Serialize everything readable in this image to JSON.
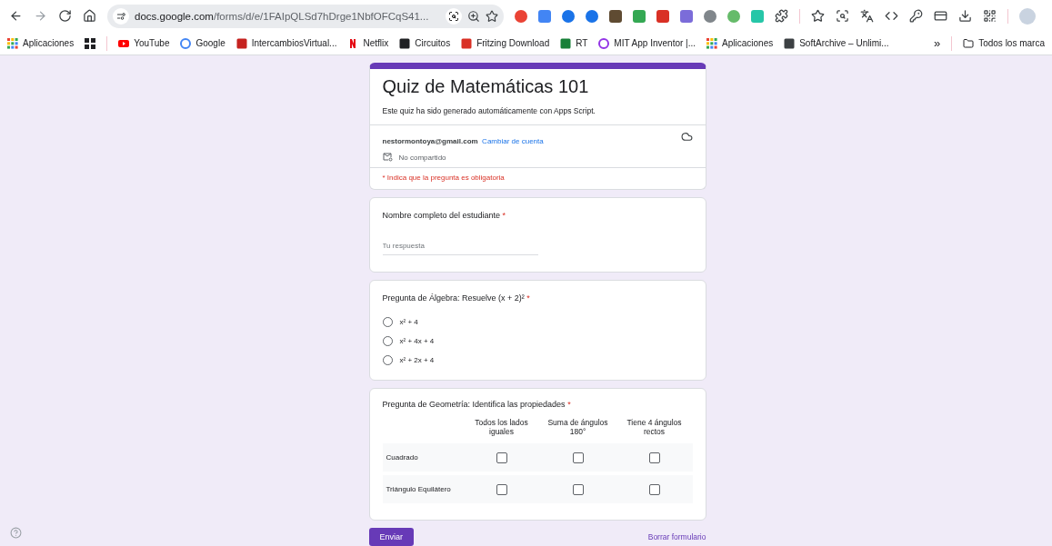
{
  "browser": {
    "address": {
      "domain": "docs.google.com",
      "path": "/forms/d/e/1FAIpQLSd7hDrge1NbfOFCqS41..."
    },
    "bookmarks": [
      {
        "label": "Aplicaciones",
        "kind": "apps"
      },
      {
        "kind": "grid",
        "color": "#202124"
      },
      {
        "label": "YouTube",
        "kind": "play",
        "color": "#ff0000"
      },
      {
        "label": "Google",
        "kind": "circle",
        "color": "#4285f4"
      },
      {
        "label": "IntercambiosVirtual...",
        "kind": "square",
        "color": "#c5221f"
      },
      {
        "label": "Netflix",
        "kind": "stripe",
        "color": "#e50914"
      },
      {
        "label": "Circuitos",
        "kind": "square",
        "color": "#202124"
      },
      {
        "label": "Fritzing Download",
        "kind": "square",
        "color": "#d93025"
      },
      {
        "label": "RT",
        "kind": "square",
        "color": "#188038"
      },
      {
        "label": "MIT App Inventor |...",
        "kind": "circle",
        "color": "#9334e6"
      },
      {
        "label": "Aplicaciones",
        "kind": "apps"
      },
      {
        "label": "SoftArchive – Unlimi...",
        "kind": "square",
        "color": "#3c4043"
      }
    ],
    "overflow": "»",
    "all_bookmarks": "Todos los marca"
  },
  "form": {
    "title": "Quiz de Matemáticas 101",
    "description": "Este quiz ha sido generado automáticamente con Apps Script.",
    "email": "nestormontoya@gmail.com",
    "switch_account": "Cambiar de cuenta",
    "sharing": "No compartido",
    "required_note": "* Indica que la pregunta es obligatoria",
    "questions": [
      {
        "kind": "text",
        "title": "Nombre completo del estudiante",
        "mark": "*",
        "placeholder": "Tu respuesta"
      },
      {
        "kind": "radio",
        "title": "Pregunta de Álgebra: Resuelve (x + 2)²",
        "mark": "*",
        "options": [
          {
            "label": "x² + 4",
            "selected": false
          },
          {
            "label": "x² + 4x + 4",
            "selected": false
          },
          {
            "label": "x² + 2x + 4",
            "selected": false
          }
        ]
      },
      {
        "kind": "grid",
        "title": "Pregunta de Geometría: Identifica las propiedades",
        "mark": "*",
        "columns": [
          "Todos los lados iguales",
          "Suma de ángulos 180°",
          "Tiene 4 ángulos rectos"
        ],
        "rows": [
          {
            "label": "Cuadrado",
            "cells": [
              {
                "checked": false
              },
              {
                "checked": false
              },
              {
                "checked": false
              }
            ]
          },
          {
            "label": "Triángulo Equilátero",
            "cells": [
              {
                "checked": false
              },
              {
                "checked": false
              },
              {
                "checked": false
              }
            ]
          }
        ]
      }
    ],
    "submit": "Enviar",
    "clear": "Borrar formulario"
  }
}
